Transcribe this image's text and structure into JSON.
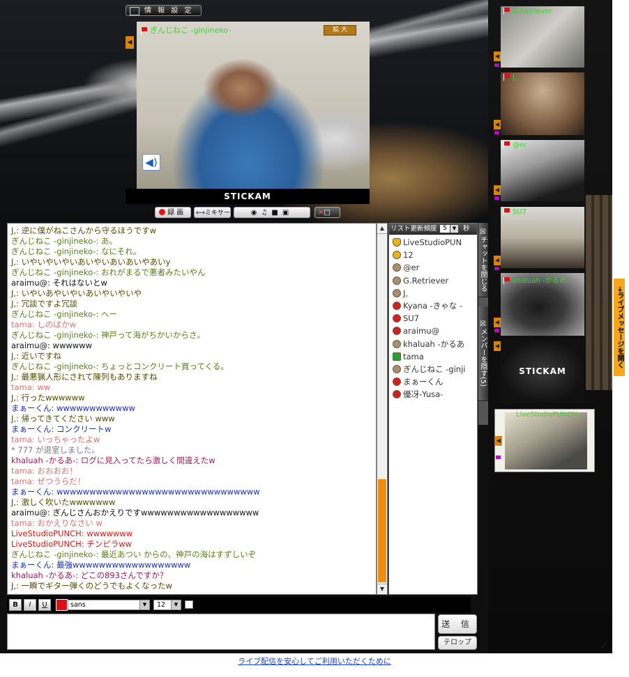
{
  "header": {
    "info_settings": "情 報 設 定"
  },
  "main_cam": {
    "name": "ぎんじねこ -ginjineko-",
    "zoom": "拡 大",
    "brand": "STICKAM"
  },
  "toolbar": {
    "record": "録 画",
    "mixer": "ミキサー"
  },
  "chat": [
    {
      "text": "J,: 逆に僕がねこさんから守るほうですw",
      "color": "#4d4d00"
    },
    {
      "text": "ぎんじねこ -ginjineko-: あ。",
      "color": "#5a7d1a"
    },
    {
      "text": "ぎんじねこ -ginjineko-: なにそれ。",
      "color": "#5a7d1a"
    },
    {
      "text": "J,: いやいやいやいあいやいあいあいやあいy",
      "color": "#4d4d00"
    },
    {
      "text": "ぎんじねこ -ginjineko-: おれがまるで悪者みたいやん",
      "color": "#5a7d1a"
    },
    {
      "text": "araimu@: それはないとw",
      "color": "#111111"
    },
    {
      "text": "J,: いやいあやいやいあいやいやいや",
      "color": "#4d4d00"
    },
    {
      "text": "J,: 冗談ですよ冗談",
      "color": "#4d4d00"
    },
    {
      "text": "ぎんじねこ -ginjineko-: へー",
      "color": "#5a7d1a"
    },
    {
      "text": "tama: しのばかw",
      "color": "#e07070"
    },
    {
      "text": "ぎんじねこ -ginjineko-: 神戸って海がちかいからさ。",
      "color": "#5a7d1a"
    },
    {
      "text": "araimu@: wwwwww",
      "color": "#111111"
    },
    {
      "text": "J,: 近いですね",
      "color": "#4d4d00"
    },
    {
      "text": "ぎんじねこ -ginjineko-: ちょっとコンクリート買ってくる。",
      "color": "#5a7d1a"
    },
    {
      "text": "J,: 最悪猟人形にされて陳列もありますね",
      "color": "#4d4d00"
    },
    {
      "text": "tama: ww",
      "color": "#e07070"
    },
    {
      "text": "J,: 行ったwwwwww",
      "color": "#4d4d00"
    },
    {
      "text": "まぁーくん: wwwwwwwwwwww",
      "color": "#1a2fb5"
    },
    {
      "text": "J,: 帰ってきてください www",
      "color": "#4d4d00"
    },
    {
      "text": "まぁーくん: コンクリートw",
      "color": "#1a2fb5"
    },
    {
      "text": "tama: いっちゃったよw",
      "color": "#e07070"
    },
    {
      "text": "* 777 が退室しました。",
      "color": "#7a7a7a"
    },
    {
      "text": "khaluah -かるあ-: ログに見入ってたら激しく間違えたw",
      "color": "#9a1a5a"
    },
    {
      "text": "tama: おおおお！",
      "color": "#e07070"
    },
    {
      "text": "tama: ぜつうらだ！",
      "color": "#e07070"
    },
    {
      "text": "まぁーくん: wwwwwwwwwwwwwwwwwwwwwwwwwwwwwww",
      "color": "#1a2fb5"
    },
    {
      "text": "J,: 激しく吹いたwwwwwww",
      "color": "#4d4d00"
    },
    {
      "text": "araimu@: ぎんじさんおかえりですwwwwwwwwwwwwwwwwww",
      "color": "#111111"
    },
    {
      "text": "tama: おかえりなさい w",
      "color": "#e07070"
    },
    {
      "text": "LiveStudioPUNCH: wwwwwww",
      "color": "#e01515"
    },
    {
      "text": "LiveStudioPUNCH: チンピラww",
      "color": "#e01515"
    },
    {
      "text": "ぎんじねこ -ginjineko-: 最近あつい からの、神戸の海はすずしいぞ",
      "color": "#5a7d1a"
    },
    {
      "text": "まぁーくん: 最強wwwwwwwwwwwwwwwwww",
      "color": "#1a2fb5"
    },
    {
      "text": "khaluah -かるあ-: どこの893さんですか？",
      "color": "#9a1a5a"
    },
    {
      "text": "J,: 一瞬でギター弾くのどうでもよくなったw",
      "color": "#4d4d00"
    }
  ],
  "users_panel": {
    "rate_label": "リスト更新頻度",
    "rate_value": "5",
    "rate_unit": "秒"
  },
  "users": [
    {
      "name": "LiveStudioPUN",
      "icon": "hat"
    },
    {
      "name": "12",
      "icon": "gold"
    },
    {
      "name": "@er",
      "icon": "brown"
    },
    {
      "name": "G.Retriever",
      "icon": "brown"
    },
    {
      "name": "J,",
      "icon": "brown"
    },
    {
      "name": "Kyana -きゃな -",
      "icon": "red"
    },
    {
      "name": "SU7",
      "icon": "red"
    },
    {
      "name": "araimu@",
      "icon": "red"
    },
    {
      "name": "khaluah -かるあ",
      "icon": "brown"
    },
    {
      "name": "tama",
      "icon": "green"
    },
    {
      "name": "ぎんじねこ -ginji",
      "icon": "brown"
    },
    {
      "name": "まぁーくん",
      "icon": "red"
    },
    {
      "name": "優冴-Yusa-",
      "icon": "red"
    }
  ],
  "side_tabs": {
    "close_chat": "チャットを閉じる",
    "hide_members": "メンバーを隠す(5)"
  },
  "compose": {
    "bold": "B",
    "italic": "I",
    "underline": "U",
    "font": "sans",
    "size": "12",
    "send": "送 信",
    "telop": "テロップ"
  },
  "thumbs": [
    {
      "name": "G.Retriever"
    },
    {
      "name": "J,"
    },
    {
      "name": "@er"
    },
    {
      "name": "SU7"
    },
    {
      "name": "khaluah -かるあ-"
    },
    {
      "name": "STICKAM"
    },
    {
      "name": "LiveStudioPUNCH"
    }
  ],
  "live_message_tab": "ライブメッセージを開く",
  "footer_link": "ライブ配信を安心してご利用いただくために",
  "colors": {
    "accent_orange": "#ef8d11",
    "cam_name_green": "#3bd32a",
    "link_blue": "#1a3fd6"
  }
}
